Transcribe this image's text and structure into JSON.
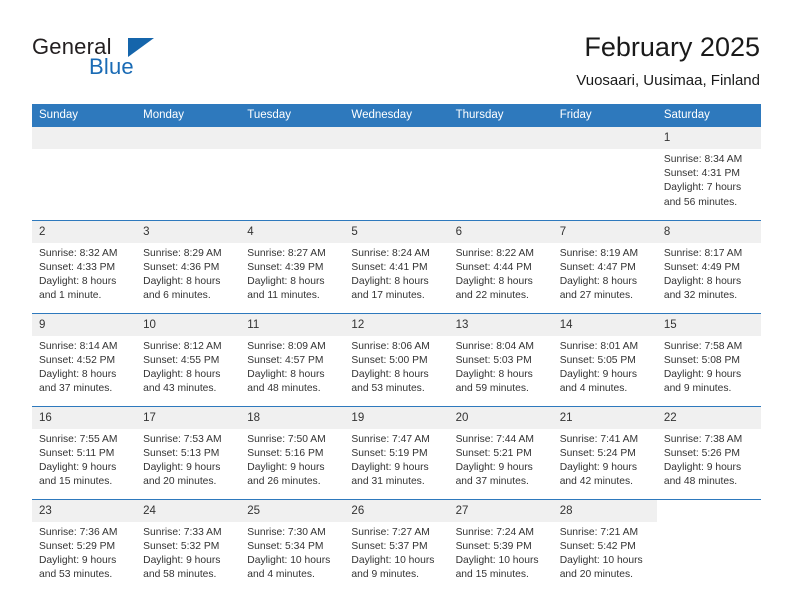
{
  "brand": {
    "word_one": "General",
    "word_two": "Blue",
    "triangle_color": "#1565ab",
    "blue_text_color": "#1a6bb5",
    "logo_icon": "general-blue-triangle-logo"
  },
  "header": {
    "month_title": "February 2025",
    "location": "Vuosaari, Uusimaa, Finland"
  },
  "calendar": {
    "header_bg": "#2e79bd",
    "daynum_bg": "#f0f0f0",
    "weekdays": [
      "Sunday",
      "Monday",
      "Tuesday",
      "Wednesday",
      "Thursday",
      "Friday",
      "Saturday"
    ],
    "weeks": [
      [
        {
          "day": "",
          "empty": true
        },
        {
          "day": "",
          "empty": true
        },
        {
          "day": "",
          "empty": true
        },
        {
          "day": "",
          "empty": true
        },
        {
          "day": "",
          "empty": true
        },
        {
          "day": "",
          "empty": true
        },
        {
          "day": "1",
          "sunrise": "Sunrise: 8:34 AM",
          "sunset": "Sunset: 4:31 PM",
          "daylight1": "Daylight: 7 hours",
          "daylight2": "and 56 minutes."
        }
      ],
      [
        {
          "day": "2",
          "sunrise": "Sunrise: 8:32 AM",
          "sunset": "Sunset: 4:33 PM",
          "daylight1": "Daylight: 8 hours",
          "daylight2": "and 1 minute."
        },
        {
          "day": "3",
          "sunrise": "Sunrise: 8:29 AM",
          "sunset": "Sunset: 4:36 PM",
          "daylight1": "Daylight: 8 hours",
          "daylight2": "and 6 minutes."
        },
        {
          "day": "4",
          "sunrise": "Sunrise: 8:27 AM",
          "sunset": "Sunset: 4:39 PM",
          "daylight1": "Daylight: 8 hours",
          "daylight2": "and 11 minutes."
        },
        {
          "day": "5",
          "sunrise": "Sunrise: 8:24 AM",
          "sunset": "Sunset: 4:41 PM",
          "daylight1": "Daylight: 8 hours",
          "daylight2": "and 17 minutes."
        },
        {
          "day": "6",
          "sunrise": "Sunrise: 8:22 AM",
          "sunset": "Sunset: 4:44 PM",
          "daylight1": "Daylight: 8 hours",
          "daylight2": "and 22 minutes."
        },
        {
          "day": "7",
          "sunrise": "Sunrise: 8:19 AM",
          "sunset": "Sunset: 4:47 PM",
          "daylight1": "Daylight: 8 hours",
          "daylight2": "and 27 minutes."
        },
        {
          "day": "8",
          "sunrise": "Sunrise: 8:17 AM",
          "sunset": "Sunset: 4:49 PM",
          "daylight1": "Daylight: 8 hours",
          "daylight2": "and 32 minutes."
        }
      ],
      [
        {
          "day": "9",
          "sunrise": "Sunrise: 8:14 AM",
          "sunset": "Sunset: 4:52 PM",
          "daylight1": "Daylight: 8 hours",
          "daylight2": "and 37 minutes."
        },
        {
          "day": "10",
          "sunrise": "Sunrise: 8:12 AM",
          "sunset": "Sunset: 4:55 PM",
          "daylight1": "Daylight: 8 hours",
          "daylight2": "and 43 minutes."
        },
        {
          "day": "11",
          "sunrise": "Sunrise: 8:09 AM",
          "sunset": "Sunset: 4:57 PM",
          "daylight1": "Daylight: 8 hours",
          "daylight2": "and 48 minutes."
        },
        {
          "day": "12",
          "sunrise": "Sunrise: 8:06 AM",
          "sunset": "Sunset: 5:00 PM",
          "daylight1": "Daylight: 8 hours",
          "daylight2": "and 53 minutes."
        },
        {
          "day": "13",
          "sunrise": "Sunrise: 8:04 AM",
          "sunset": "Sunset: 5:03 PM",
          "daylight1": "Daylight: 8 hours",
          "daylight2": "and 59 minutes."
        },
        {
          "day": "14",
          "sunrise": "Sunrise: 8:01 AM",
          "sunset": "Sunset: 5:05 PM",
          "daylight1": "Daylight: 9 hours",
          "daylight2": "and 4 minutes."
        },
        {
          "day": "15",
          "sunrise": "Sunrise: 7:58 AM",
          "sunset": "Sunset: 5:08 PM",
          "daylight1": "Daylight: 9 hours",
          "daylight2": "and 9 minutes."
        }
      ],
      [
        {
          "day": "16",
          "sunrise": "Sunrise: 7:55 AM",
          "sunset": "Sunset: 5:11 PM",
          "daylight1": "Daylight: 9 hours",
          "daylight2": "and 15 minutes."
        },
        {
          "day": "17",
          "sunrise": "Sunrise: 7:53 AM",
          "sunset": "Sunset: 5:13 PM",
          "daylight1": "Daylight: 9 hours",
          "daylight2": "and 20 minutes."
        },
        {
          "day": "18",
          "sunrise": "Sunrise: 7:50 AM",
          "sunset": "Sunset: 5:16 PM",
          "daylight1": "Daylight: 9 hours",
          "daylight2": "and 26 minutes."
        },
        {
          "day": "19",
          "sunrise": "Sunrise: 7:47 AM",
          "sunset": "Sunset: 5:19 PM",
          "daylight1": "Daylight: 9 hours",
          "daylight2": "and 31 minutes."
        },
        {
          "day": "20",
          "sunrise": "Sunrise: 7:44 AM",
          "sunset": "Sunset: 5:21 PM",
          "daylight1": "Daylight: 9 hours",
          "daylight2": "and 37 minutes."
        },
        {
          "day": "21",
          "sunrise": "Sunrise: 7:41 AM",
          "sunset": "Sunset: 5:24 PM",
          "daylight1": "Daylight: 9 hours",
          "daylight2": "and 42 minutes."
        },
        {
          "day": "22",
          "sunrise": "Sunrise: 7:38 AM",
          "sunset": "Sunset: 5:26 PM",
          "daylight1": "Daylight: 9 hours",
          "daylight2": "and 48 minutes."
        }
      ],
      [
        {
          "day": "23",
          "sunrise": "Sunrise: 7:36 AM",
          "sunset": "Sunset: 5:29 PM",
          "daylight1": "Daylight: 9 hours",
          "daylight2": "and 53 minutes."
        },
        {
          "day": "24",
          "sunrise": "Sunrise: 7:33 AM",
          "sunset": "Sunset: 5:32 PM",
          "daylight1": "Daylight: 9 hours",
          "daylight2": "and 58 minutes."
        },
        {
          "day": "25",
          "sunrise": "Sunrise: 7:30 AM",
          "sunset": "Sunset: 5:34 PM",
          "daylight1": "Daylight: 10 hours",
          "daylight2": "and 4 minutes."
        },
        {
          "day": "26",
          "sunrise": "Sunrise: 7:27 AM",
          "sunset": "Sunset: 5:37 PM",
          "daylight1": "Daylight: 10 hours",
          "daylight2": "and 9 minutes."
        },
        {
          "day": "27",
          "sunrise": "Sunrise: 7:24 AM",
          "sunset": "Sunset: 5:39 PM",
          "daylight1": "Daylight: 10 hours",
          "daylight2": "and 15 minutes."
        },
        {
          "day": "28",
          "sunrise": "Sunrise: 7:21 AM",
          "sunset": "Sunset: 5:42 PM",
          "daylight1": "Daylight: 10 hours",
          "daylight2": "and 20 minutes."
        },
        {
          "day": "",
          "empty": true,
          "no_band": true
        }
      ]
    ]
  }
}
